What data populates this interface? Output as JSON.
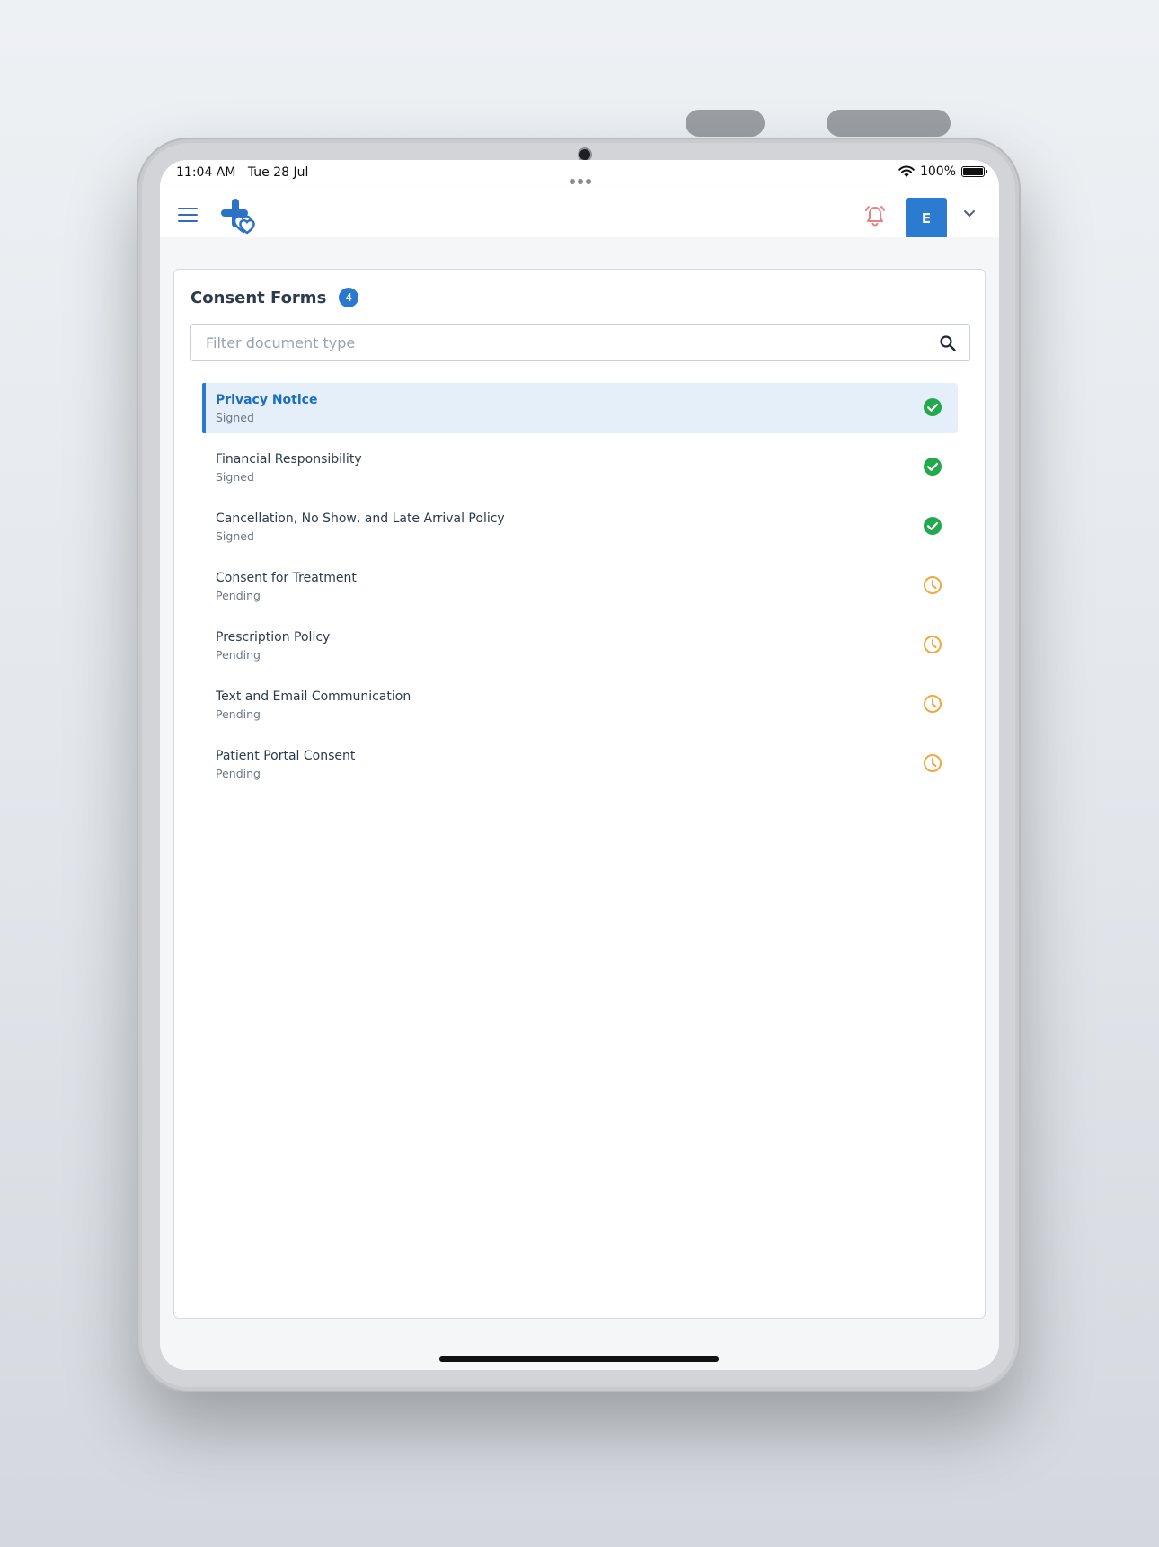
{
  "status_bar": {
    "time": "11:04 AM",
    "date": "Tue 28 Jul",
    "battery": "100%",
    "icons": [
      "wifi-icon",
      "battery-icon"
    ]
  },
  "header": {
    "menu_icon": "hamburger-menu-icon",
    "logo": "cross-heart-logo",
    "alert_icon": "alarm-bell-icon",
    "avatar_initial": "E",
    "dropdown_icon": "chevron-down-icon"
  },
  "consent_forms": {
    "title": "Consent Forms",
    "count": "4",
    "search": {
      "placeholder": "Filter document type",
      "value": "",
      "icon": "search-icon"
    },
    "items": [
      {
        "title": "Privacy Notice",
        "status": "Signed",
        "icon": "check-circle-icon",
        "selected": true
      },
      {
        "title": "Financial Responsibility",
        "status": "Signed",
        "icon": "check-circle-icon"
      },
      {
        "title": "Cancellation, No Show, and Late Arrival Policy",
        "status": "Signed",
        "icon": "check-circle-icon"
      },
      {
        "title": "Consent for Treatment",
        "status": "Pending",
        "icon": "clock-icon"
      },
      {
        "title": "Prescription Policy",
        "status": "Pending",
        "icon": "clock-icon"
      },
      {
        "title": "Text and Email Communication",
        "status": "Pending",
        "icon": "clock-icon"
      },
      {
        "title": "Patient Portal Consent",
        "status": "Pending",
        "icon": "clock-icon"
      }
    ]
  },
  "colors": {
    "primary": "#2b78d0",
    "signed": "#22a94e",
    "pending": "#f0a93a",
    "alert": "#e88080",
    "selected_bg": "#e4effa"
  }
}
